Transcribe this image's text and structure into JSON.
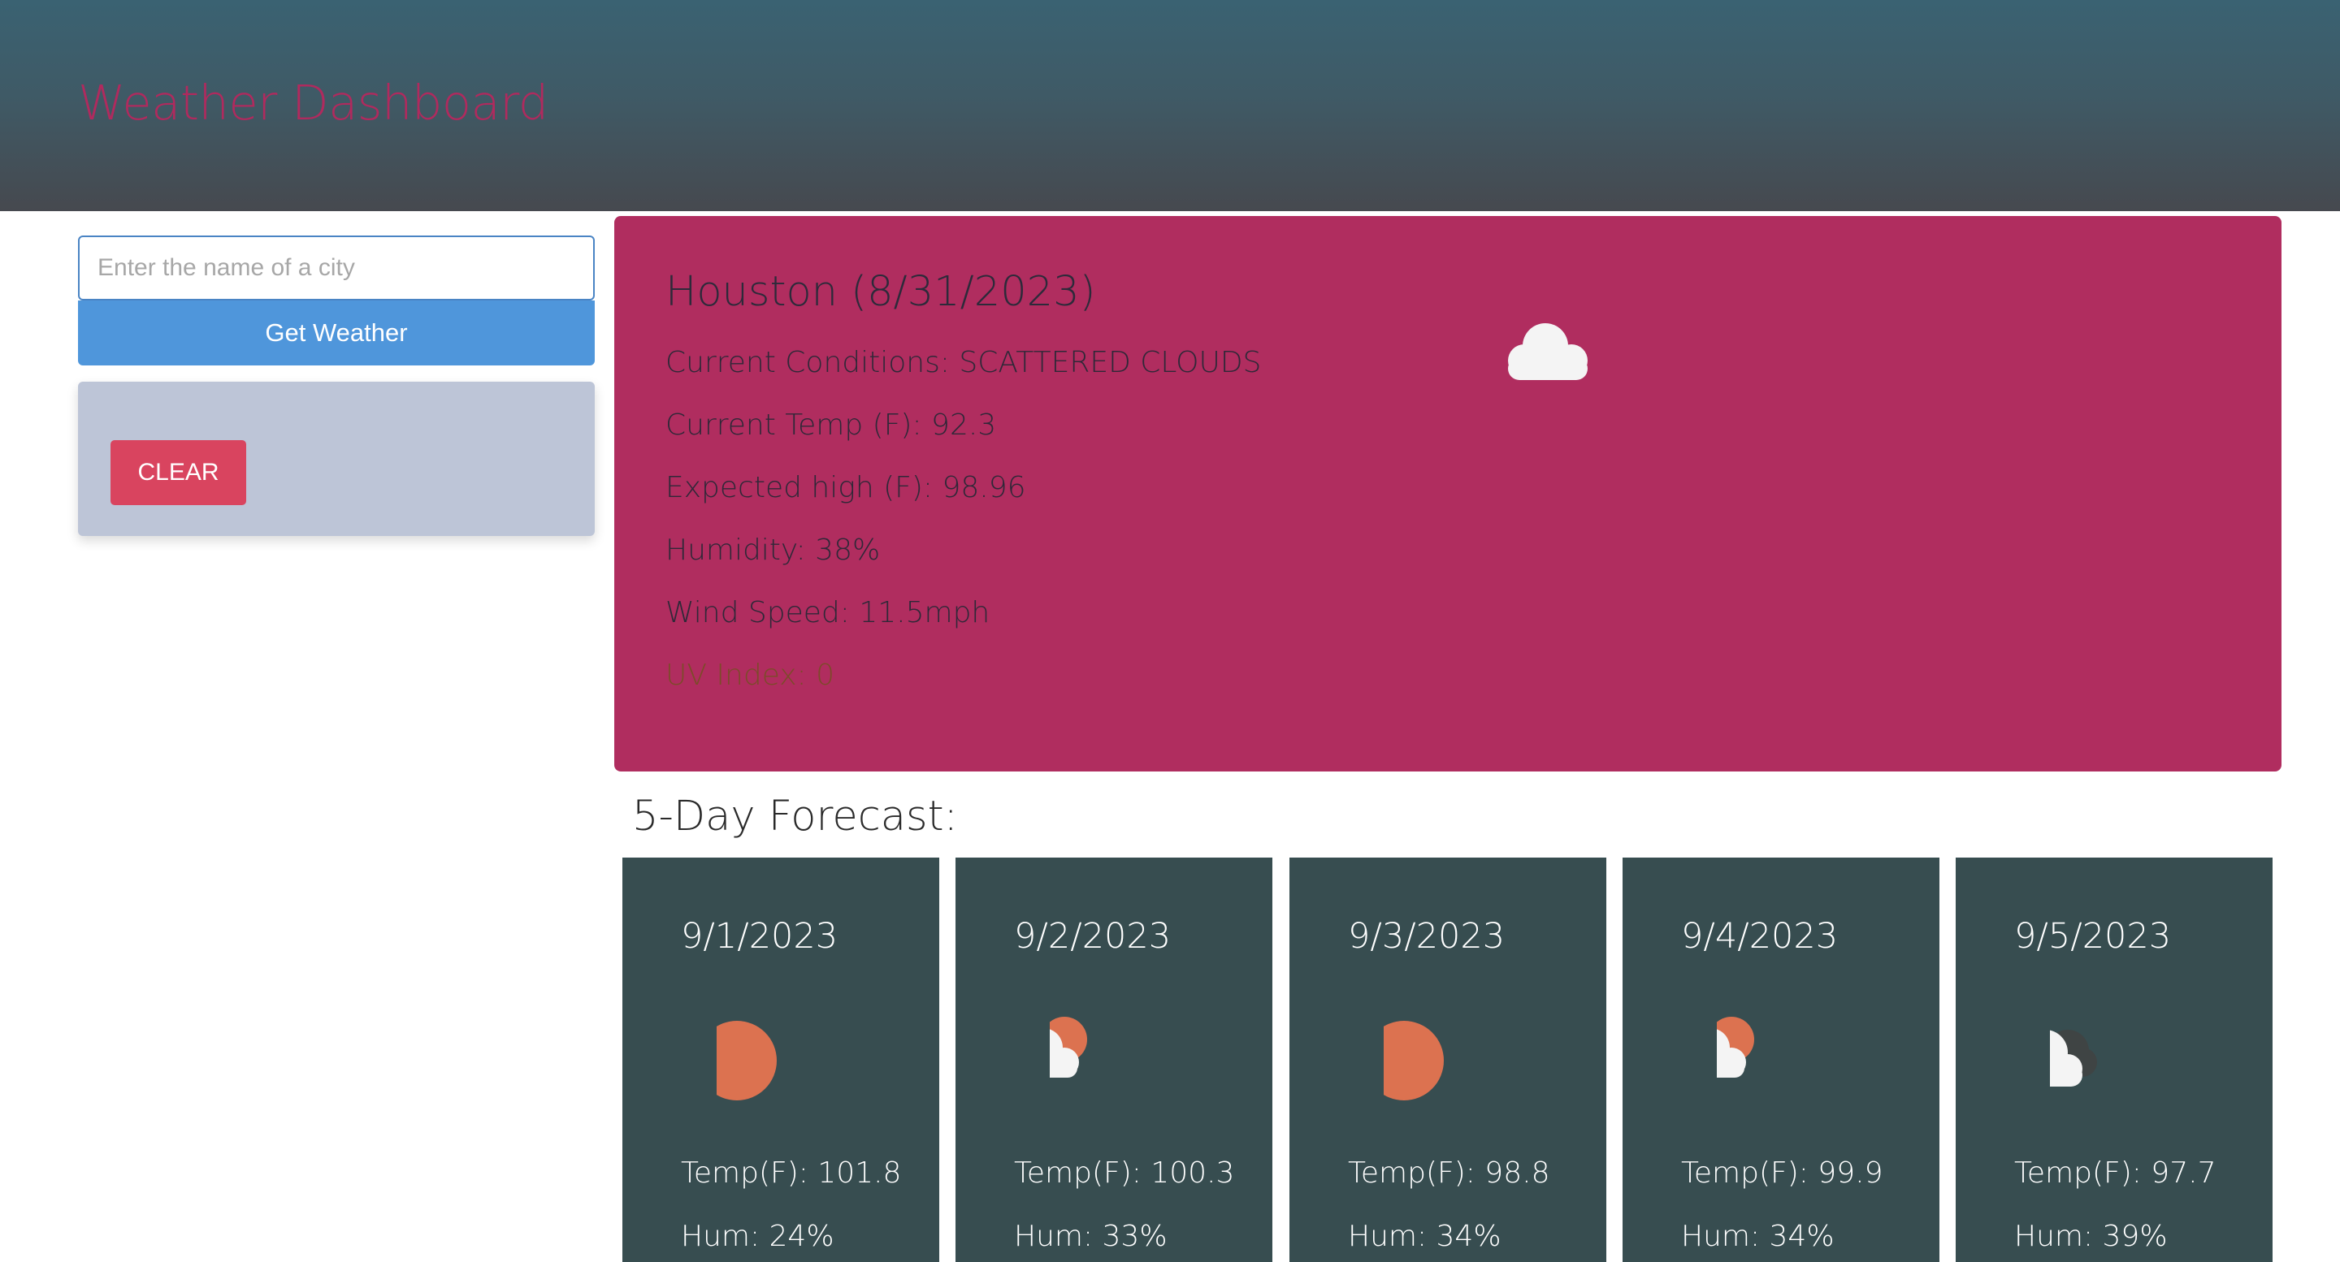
{
  "header": {
    "title": "Weather Dashboard"
  },
  "search": {
    "placeholder": "Enter the name of a city",
    "button_label": "Get Weather"
  },
  "history": {
    "clear_label": "CLEAR"
  },
  "current": {
    "title": "Houston (8/31/2023)",
    "conditions": "Current Conditions: SCATTERED CLOUDS",
    "temp": "Current Temp (F): 92.3",
    "high": "Expected high (F): 98.96",
    "humidity": "Humidity: 38%",
    "wind": "Wind Speed: 11.5mph",
    "uv": "UV Index: 0",
    "icon": "cloud-icon"
  },
  "forecast": {
    "heading": "5-Day Forecast:",
    "days": [
      {
        "date": "9/1/2023",
        "icon": "sun-icon",
        "temp": "Temp(F): 101.8",
        "hum": "Hum: 24%"
      },
      {
        "date": "9/2/2023",
        "icon": "partly-cloudy-icon",
        "temp": "Temp(F): 100.3",
        "hum": "Hum: 33%"
      },
      {
        "date": "9/3/2023",
        "icon": "sun-icon",
        "temp": "Temp(F): 98.8",
        "hum": "Hum: 34%"
      },
      {
        "date": "9/4/2023",
        "icon": "partly-cloudy-rain-icon",
        "temp": "Temp(F): 99.9",
        "hum": "Hum: 34%"
      },
      {
        "date": "9/5/2023",
        "icon": "broken-clouds-icon",
        "temp": "Temp(F): 97.7",
        "hum": "Hum: 39%"
      }
    ]
  },
  "colors": {
    "header_title": "#b02a5e",
    "current_card": "#b02d5f",
    "forecast_card": "#374d50",
    "button": "#4f96db",
    "clear_button": "#d9445f",
    "sun": "#dc7250"
  }
}
